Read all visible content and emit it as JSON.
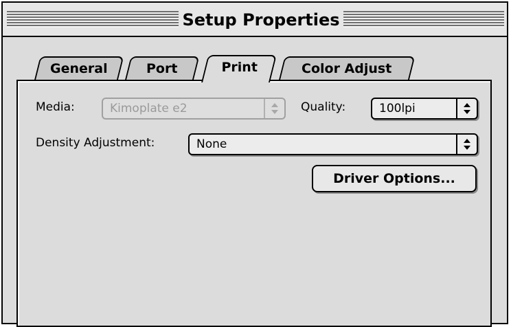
{
  "window": {
    "title": "Setup Properties"
  },
  "tabs": [
    {
      "label": "General"
    },
    {
      "label": "Port"
    },
    {
      "label": "Print"
    },
    {
      "label": "Color Adjust"
    }
  ],
  "active_tab": "Print",
  "form": {
    "media": {
      "label": "Media:",
      "value": "Kimoplate e2",
      "disabled": true
    },
    "quality": {
      "label": "Quality:",
      "value": "100lpi"
    },
    "density": {
      "label": "Density Adjustment:",
      "value": "None"
    },
    "driver_options_label": "Driver Options..."
  },
  "icons": {
    "popup_arrows": "up-down-arrows-icon"
  },
  "colors": {
    "background": "#dcdcdc",
    "disabled_text": "#9a9a9a"
  }
}
